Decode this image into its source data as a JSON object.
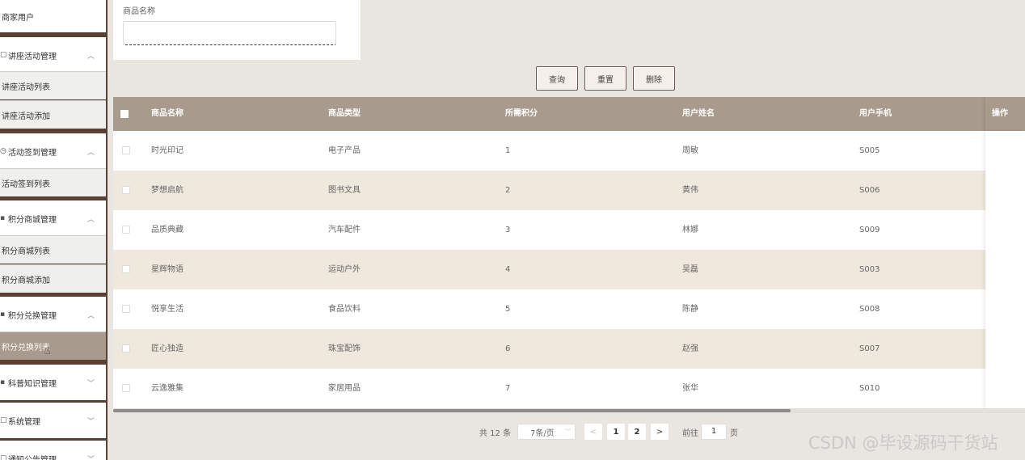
{
  "sidebar": {
    "merchant_users": "商家用户",
    "lecture_mgmt": "讲座活动管理",
    "lecture_list": "讲座活动列表",
    "lecture_add": "讲座活动添加",
    "checkin_mgmt": "活动签到管理",
    "checkin_list": "活动签到列表",
    "mall_mgmt": "积分商城管理",
    "mall_list": "积分商城列表",
    "mall_add": "积分商城添加",
    "exchange_mgmt": "积分兑换管理",
    "exchange_list": "积分兑换列表",
    "science_mgmt": "科普知识管理",
    "system_mgmt": "系统管理",
    "notice_mgmt": "通知公告管理"
  },
  "search": {
    "label": "商品名称",
    "placeholder": ""
  },
  "toolbar": {
    "query": "查询",
    "reset": "重置",
    "delete": "删除"
  },
  "table": {
    "headers": [
      "商品名称",
      "商品类型",
      "所需积分",
      "用户姓名",
      "用户手机",
      "操作"
    ],
    "rows": [
      {
        "name": "时光印记",
        "type": "电子产品",
        "points": "1",
        "user": "周敏",
        "phone": "S005"
      },
      {
        "name": "梦想启航",
        "type": "图书文具",
        "points": "2",
        "user": "黄伟",
        "phone": "S006"
      },
      {
        "name": "品质典藏",
        "type": "汽车配件",
        "points": "3",
        "user": "林娜",
        "phone": "S009"
      },
      {
        "name": "星辉物语",
        "type": "运动户外",
        "points": "4",
        "user": "吴磊",
        "phone": "S003"
      },
      {
        "name": "悦享生活",
        "type": "食品饮料",
        "points": "5",
        "user": "陈静",
        "phone": "S008"
      },
      {
        "name": "匠心独造",
        "type": "珠宝配饰",
        "points": "6",
        "user": "赵强",
        "phone": "S007"
      },
      {
        "name": "云逸雅集",
        "type": "家居用品",
        "points": "7",
        "user": "张华",
        "phone": "S010"
      }
    ]
  },
  "pagination": {
    "total": "共 12 条",
    "page_size": "7条/页",
    "prev": "<",
    "page1": "1",
    "page2": "2",
    "next": ">",
    "goto": "前往",
    "goto_value": "1",
    "page_unit": "页"
  },
  "watermark": "CSDN @毕设源码干货站"
}
